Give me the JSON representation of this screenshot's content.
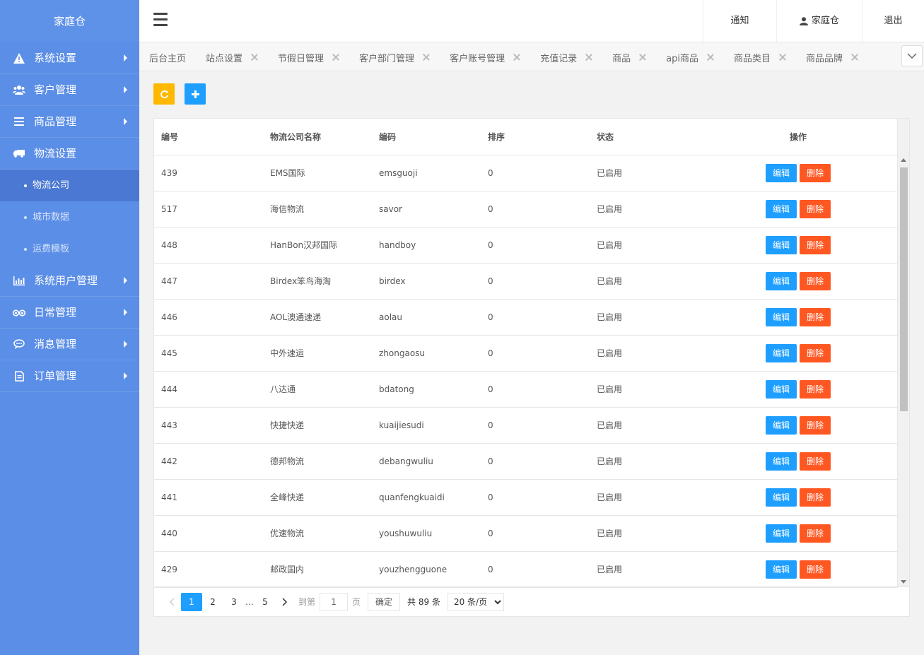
{
  "app": {
    "logo": "家庭仓"
  },
  "sidebar": {
    "items": [
      {
        "label": "系统设置",
        "icon": "warning-icon"
      },
      {
        "label": "客户管理",
        "icon": "users-icon"
      },
      {
        "label": "商品管理",
        "icon": "list-icon"
      },
      {
        "label": "物流设置",
        "icon": "truck-icon"
      },
      {
        "label": "系统用户管理",
        "icon": "bar-chart-icon"
      },
      {
        "label": "日常管理",
        "icon": "binoculars-icon"
      },
      {
        "label": "消息管理",
        "icon": "chat-icon"
      },
      {
        "label": "订单管理",
        "icon": "document-icon"
      }
    ],
    "sub_items": [
      {
        "label": "物流公司",
        "active": true
      },
      {
        "label": "城市数据",
        "active": false
      },
      {
        "label": "运费模板",
        "active": false
      }
    ]
  },
  "header": {
    "notify": "通知",
    "user": "家庭仓",
    "logout": "退出"
  },
  "tabs": [
    {
      "label": "后台主页",
      "closable": false
    },
    {
      "label": "站点设置",
      "closable": true
    },
    {
      "label": "节假日管理",
      "closable": true
    },
    {
      "label": "客户部门管理",
      "closable": true
    },
    {
      "label": "客户账号管理",
      "closable": true
    },
    {
      "label": "充值记录",
      "closable": true
    },
    {
      "label": "商品",
      "closable": true
    },
    {
      "label": "api商品",
      "closable": true
    },
    {
      "label": "商品类目",
      "closable": true
    },
    {
      "label": "商品品牌",
      "closable": true
    }
  ],
  "table": {
    "columns": [
      "编号",
      "物流公司名称",
      "编码",
      "排序",
      "状态",
      "操作"
    ],
    "edit_label": "编辑",
    "delete_label": "删除",
    "rows": [
      {
        "id": "439",
        "name": "EMS国际",
        "code": "emsguoji",
        "sort": "0",
        "status": "已启用"
      },
      {
        "id": "517",
        "name": "海信物流",
        "code": "savor",
        "sort": "0",
        "status": "已启用"
      },
      {
        "id": "448",
        "name": "HanBon汉邦国际",
        "code": "handboy",
        "sort": "0",
        "status": "已启用"
      },
      {
        "id": "447",
        "name": "Birdex笨鸟海淘",
        "code": "birdex",
        "sort": "0",
        "status": "已启用"
      },
      {
        "id": "446",
        "name": "AOL澳通速递",
        "code": "aolau",
        "sort": "0",
        "status": "已启用"
      },
      {
        "id": "445",
        "name": "中外速运",
        "code": "zhongaosu",
        "sort": "0",
        "status": "已启用"
      },
      {
        "id": "444",
        "name": "八达通",
        "code": "bdatong",
        "sort": "0",
        "status": "已启用"
      },
      {
        "id": "443",
        "name": "快捷快递",
        "code": "kuaijiesudi",
        "sort": "0",
        "status": "已启用"
      },
      {
        "id": "442",
        "name": "德邦物流",
        "code": "debangwuliu",
        "sort": "0",
        "status": "已启用"
      },
      {
        "id": "441",
        "name": "全峰快递",
        "code": "quanfengkuaidi",
        "sort": "0",
        "status": "已启用"
      },
      {
        "id": "440",
        "name": "优速物流",
        "code": "youshuwuliu",
        "sort": "0",
        "status": "已启用"
      },
      {
        "id": "429",
        "name": "邮政国内",
        "code": "youzhengguone",
        "sort": "0",
        "status": "已启用"
      }
    ]
  },
  "pager": {
    "pages": [
      "1",
      "2",
      "3"
    ],
    "ellipsis": "…",
    "last_page": "5",
    "goto_label": "到第",
    "page_input": "1",
    "page_suffix": "页",
    "confirm": "确定",
    "total": "共 89 条",
    "page_size": "20 条/页"
  },
  "colors": {
    "sidebar_bg": "#5b8ee6",
    "active_sub_bg": "#4a78d2",
    "edit_btn": "#1e9fff",
    "delete_btn": "#ff5722",
    "refresh_btn": "#ffb800",
    "add_btn": "#1e9fff"
  }
}
